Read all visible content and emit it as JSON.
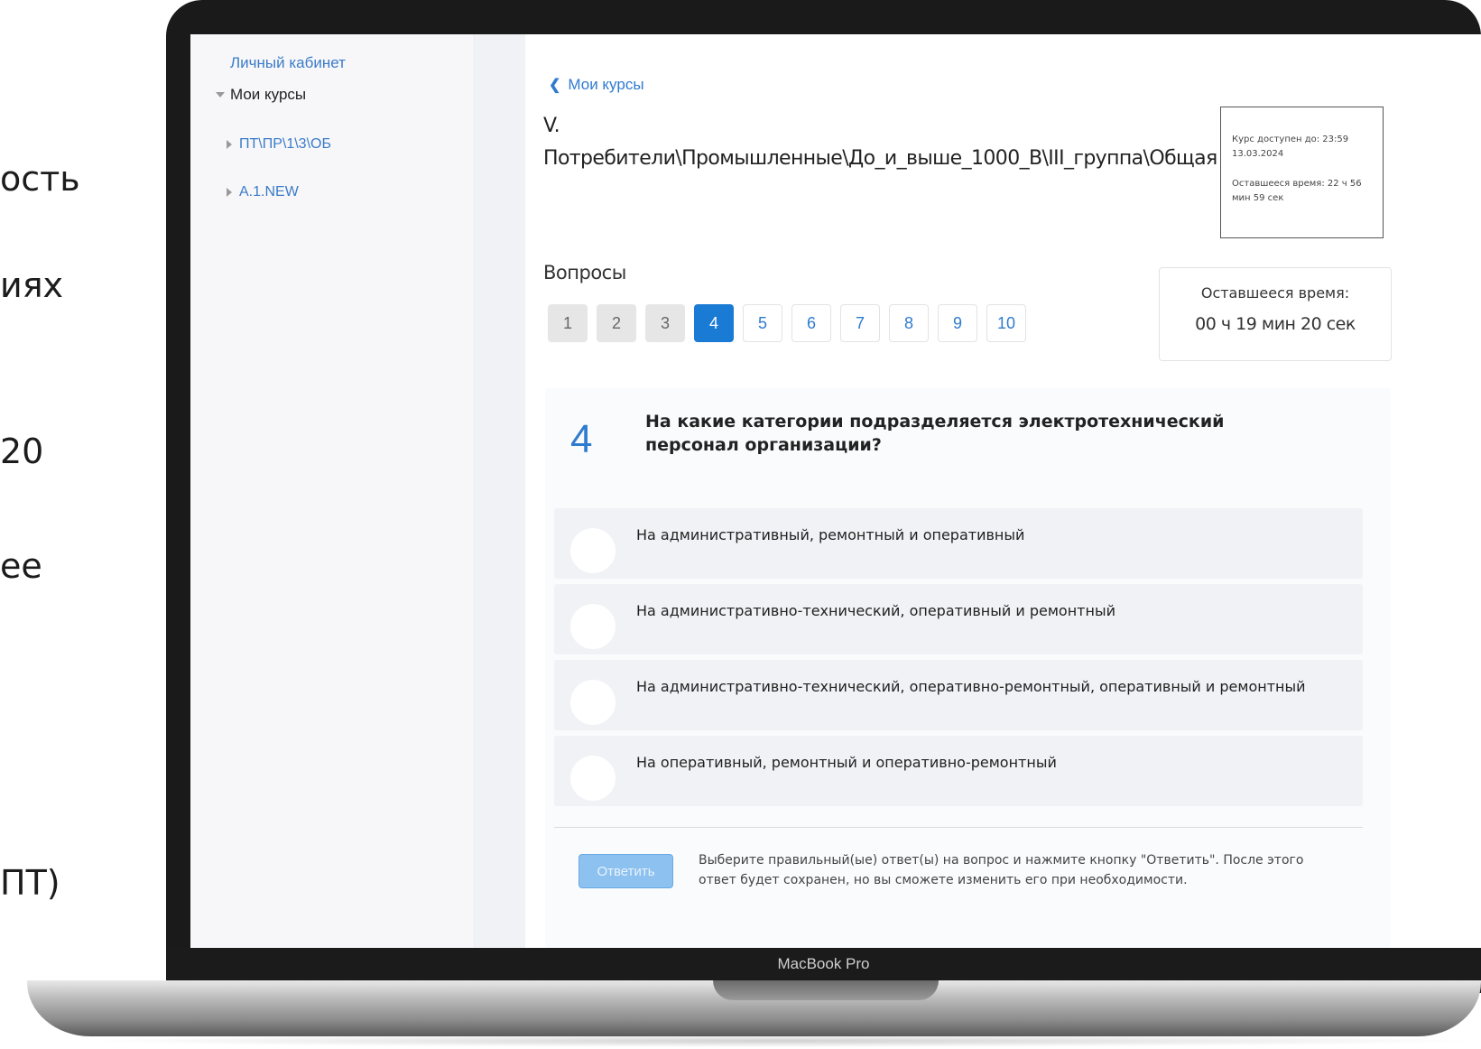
{
  "slide_fragments": [
    "ость",
    "иях",
    "20",
    "ее",
    "ПТ)"
  ],
  "laptop": {
    "brand": "MacBook Pro"
  },
  "sidebar": {
    "cabinet_link": "Личный кабинет",
    "my_courses": "Мои курсы",
    "courses": [
      "ПТ\\ПР\\1\\3\\ОБ",
      "А.1.NEW"
    ]
  },
  "main": {
    "back_link": "Мои курсы",
    "course_title": "V. Потребители\\Промышленные\\До_и_выше_1000_В\\III_группа\\Общая",
    "course_info": {
      "available_until": "Курс доступен до: 23:59 13.03.2024",
      "remaining": "Оставшееся время: 22 ч 56 мин 59 сек"
    },
    "questions_heading": "Вопросы",
    "question_numbers": [
      "1",
      "2",
      "3",
      "4",
      "5",
      "6",
      "7",
      "8",
      "9",
      "10"
    ],
    "question_states": [
      "done",
      "done",
      "done",
      "active",
      "todo",
      "todo",
      "todo",
      "todo",
      "todo",
      "todo"
    ],
    "timer": {
      "label": "Оставшееся время:",
      "value": "00 ч 19 мин 20 сек"
    },
    "question": {
      "number": "4",
      "text": "На какие категории подразделяется электротехнический персонал организации?",
      "options": [
        "На административный, ремонтный и оперативный",
        "На административно-технический, оперативный и ремонтный",
        "На административно-технический, оперативно-ремонтный, оперативный и ремонтный",
        "На оперативный, ремонтный и оперативно-ремонтный"
      ]
    },
    "submit_label": "Ответить",
    "hint": "Выберите правильный(ые) ответ(ы) на вопрос и нажмите кнопку \"Ответить\". После этого ответ будет сохранен, но вы сможете изменить его при необходимости."
  },
  "colors": {
    "accent": "#1a7bd4",
    "link": "#2f7bd0",
    "option_bg": "#f1f2f6"
  }
}
